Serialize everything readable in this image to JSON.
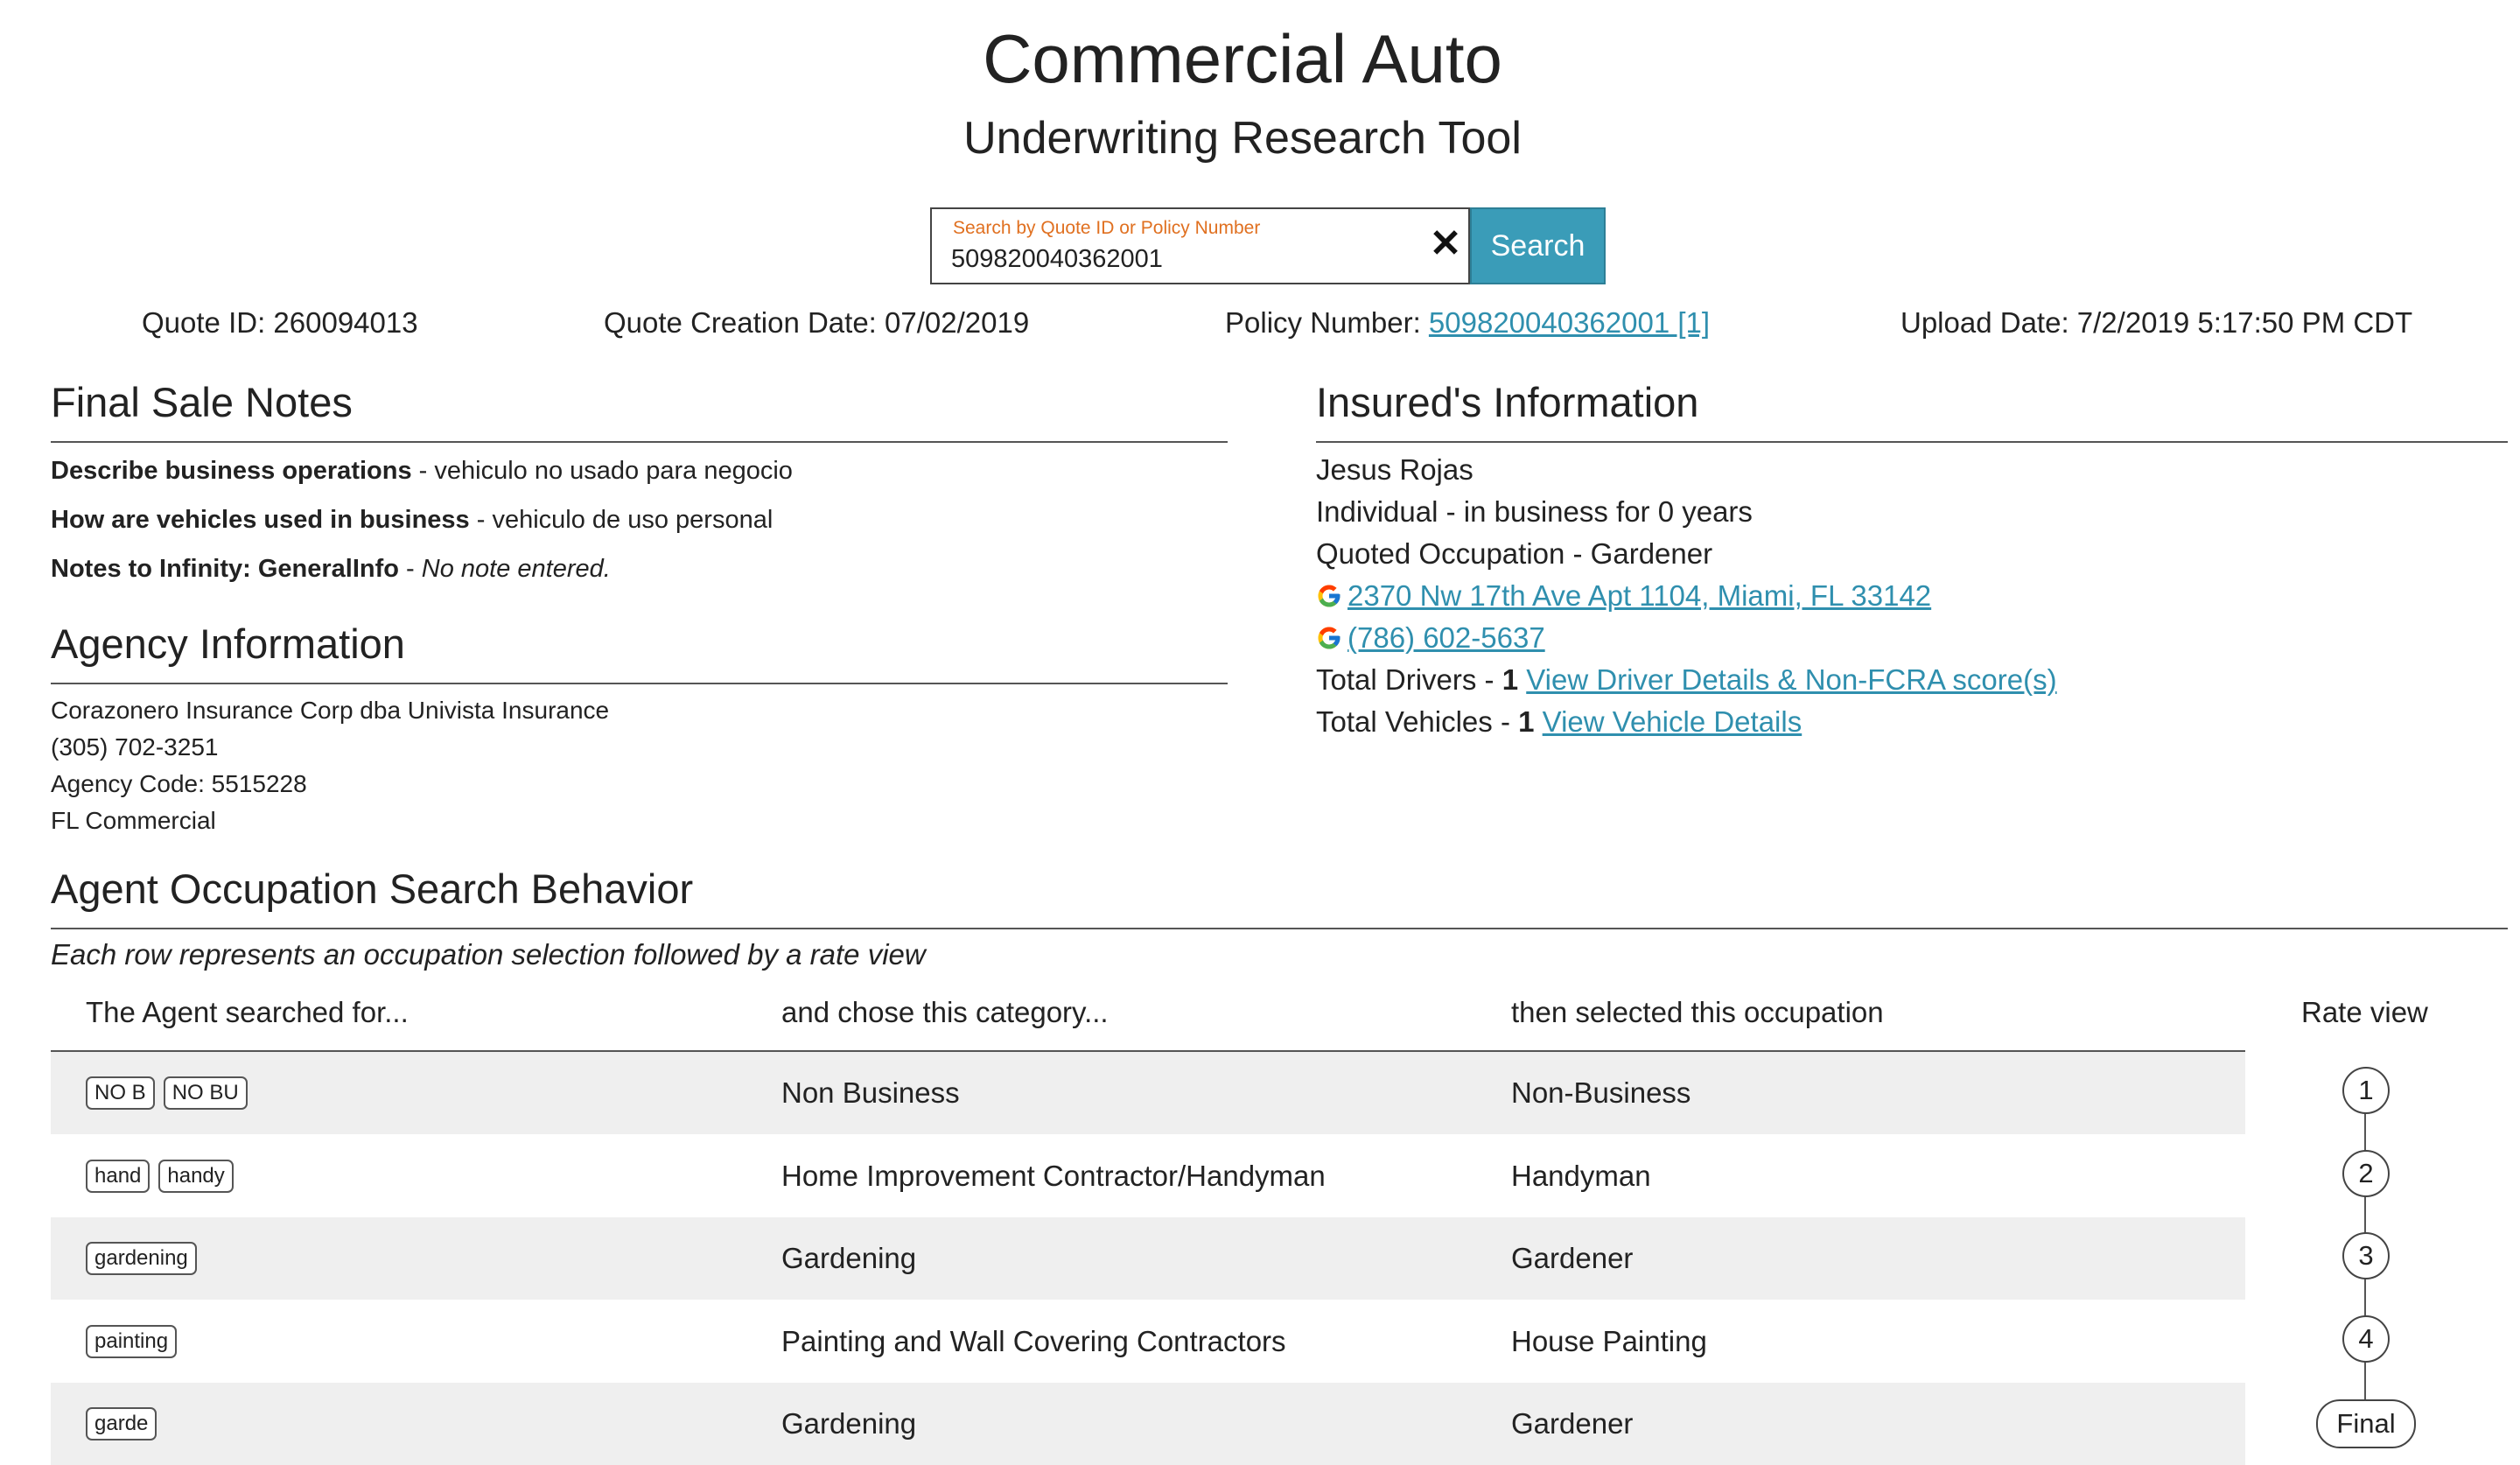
{
  "header": {
    "title": "Commercial Auto",
    "subtitle": "Underwriting Research Tool"
  },
  "search": {
    "label": "Search by Quote ID or Policy Number",
    "value": "509820040362001",
    "clear_symbol": "✕",
    "button_label": "Search"
  },
  "meta": {
    "quote_id": "Quote ID: 260094013",
    "creation_date": "Quote Creation Date: 07/02/2019",
    "policy_label": "Policy Number:",
    "policy_link": "509820040362001 [1]",
    "upload_date": "Upload Date: 7/2/2019 5:17:50 PM CDT"
  },
  "final_sale_notes": {
    "title": "Final Sale Notes",
    "items": [
      {
        "label": "Describe business operations",
        "sep": " - ",
        "value": "vehiculo no usado para negocio"
      },
      {
        "label": "How are vehicles used in business",
        "sep": " - ",
        "value": "vehiculo de uso personal"
      },
      {
        "label": "Notes to Infinity: GeneralInfo",
        "sep": " - ",
        "value": "No note entered."
      }
    ]
  },
  "agency": {
    "title": "Agency Information",
    "name": "Corazonero Insurance Corp dba Univista Insurance",
    "phone": "(305) 702-3251",
    "code": "Agency Code: 5515228",
    "line": "FL Commercial"
  },
  "insured": {
    "title": "Insured's Information",
    "name": "Jesus Rojas",
    "entity": "Individual - in business for 0 years",
    "occupation": "Quoted Occupation - Gardener",
    "address": "2370 Nw 17th Ave Apt 1104, Miami, FL 33142",
    "phone": "(786) 602-5637",
    "drivers_label": "Total Drivers - ",
    "drivers_count": "1",
    "drivers_link": "View Driver Details & Non-FCRA score(s)",
    "vehicles_label": "Total Vehicles - ",
    "vehicles_count": "1",
    "vehicles_link": "View Vehicle Details",
    "google_icon": "google-g-icon"
  },
  "behavior": {
    "title": "Agent Occupation Search Behavior",
    "note": "Each row represents an occupation selection followed by a rate view",
    "columns": {
      "searched": "The Agent searched for...",
      "category": "and chose this category...",
      "occupation": "then selected this occupation",
      "rate": "Rate view"
    },
    "rows": [
      {
        "tags": [
          "NO B",
          "NO BU"
        ],
        "category": "Non Business",
        "occupation": "Non-Business",
        "rate": "1"
      },
      {
        "tags": [
          "hand",
          "handy"
        ],
        "category": "Home Improvement Contractor/Handyman",
        "occupation": "Handyman",
        "rate": "2"
      },
      {
        "tags": [
          "gardening"
        ],
        "category": "Gardening",
        "occupation": "Gardener",
        "rate": "3"
      },
      {
        "tags": [
          "painting"
        ],
        "category": "Painting and Wall Covering Contractors",
        "occupation": "House Painting",
        "rate": "4"
      },
      {
        "tags": [
          "garde"
        ],
        "category": "Gardening",
        "occupation": "Gardener",
        "rate": "Final"
      }
    ]
  },
  "colors": {
    "accent": "#3a9cb8",
    "link": "#2f8fae",
    "label_orange": "#e07020",
    "row_shade": "#efefef"
  }
}
